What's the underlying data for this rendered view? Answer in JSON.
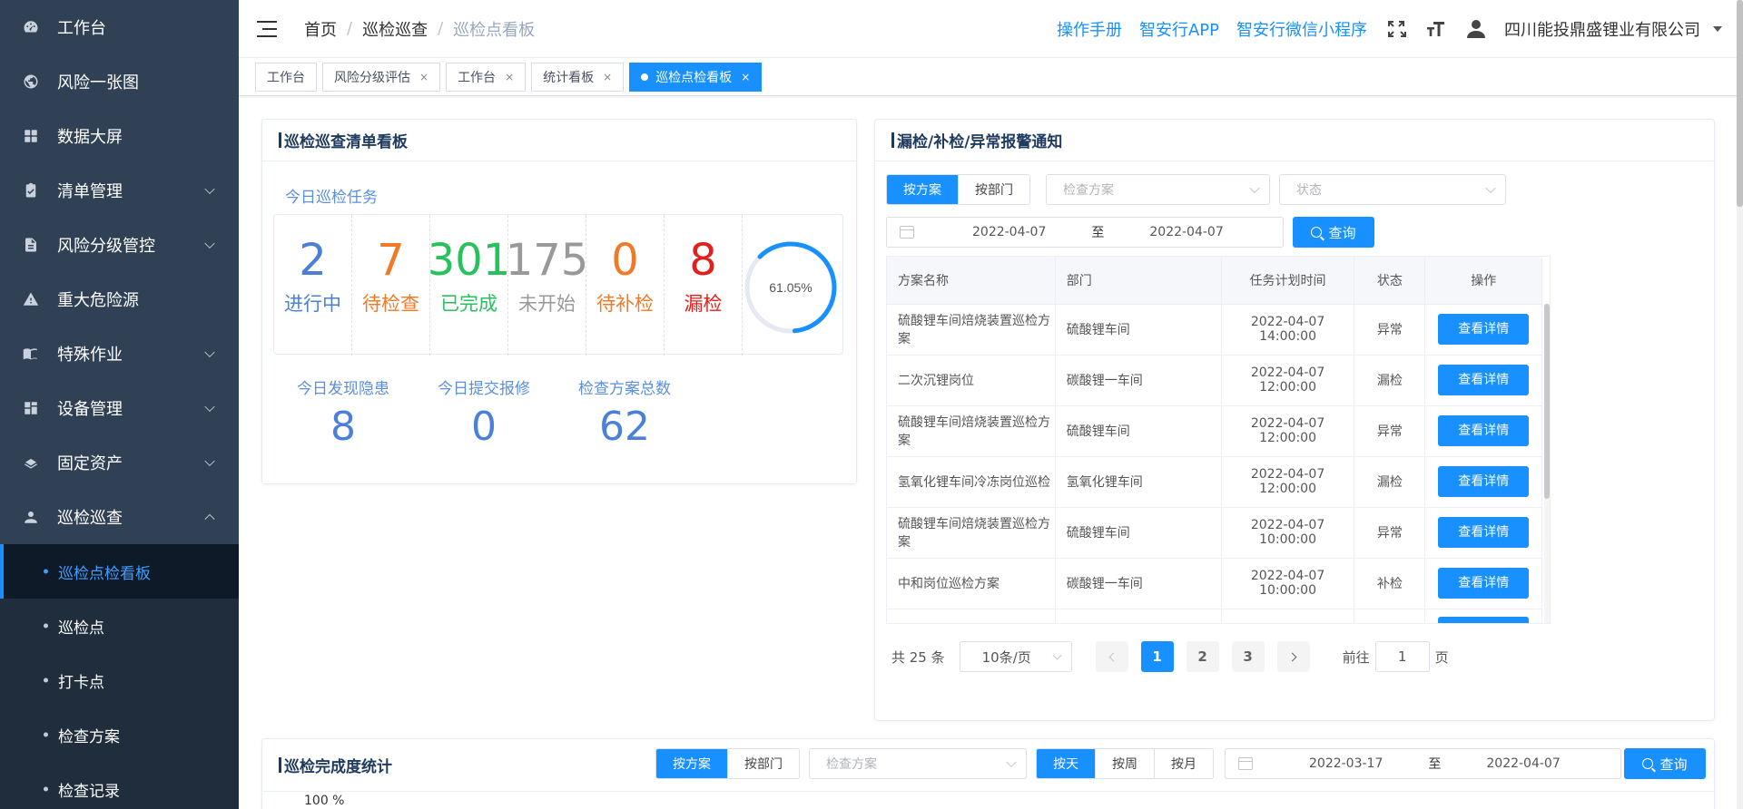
{
  "sidebar": {
    "items": [
      {
        "label": "工作台",
        "icon": "dashboard-icon"
      },
      {
        "label": "风险一张图",
        "icon": "globe-icon"
      },
      {
        "label": "数据大屏",
        "icon": "grid-icon"
      },
      {
        "label": "清单管理",
        "icon": "checklist-icon"
      },
      {
        "label": "风险分级管控",
        "icon": "document-icon"
      },
      {
        "label": "重大危险源",
        "icon": "warning-icon"
      },
      {
        "label": "特殊作业",
        "icon": "book-icon"
      },
      {
        "label": "设备管理",
        "icon": "apps-icon"
      },
      {
        "label": "固定资产",
        "icon": "layers-icon"
      },
      {
        "label": "巡检巡查",
        "icon": "inspector-icon"
      }
    ],
    "submenu": [
      "巡检点检看板",
      "巡检点",
      "打卡点",
      "检查方案",
      "检查记录"
    ]
  },
  "header": {
    "breadcrumb": [
      "首页",
      "巡检巡查",
      "巡检点看板"
    ],
    "links": [
      "操作手册",
      "智安行APP",
      "智安行微信小程序"
    ],
    "company": "四川能投鼎盛锂业有限公司"
  },
  "tabs": [
    {
      "label": "工作台",
      "closable": false
    },
    {
      "label": "风险分级评估",
      "closable": true
    },
    {
      "label": "工作台",
      "closable": true
    },
    {
      "label": "统计看板",
      "closable": true
    },
    {
      "label": "巡检点检看板",
      "closable": true
    }
  ],
  "left_card": {
    "title": "巡检巡查清单看板",
    "today_task_label": "今日巡检任务",
    "stats": [
      {
        "value": "2",
        "label": "进行中",
        "color": "#4a80d8"
      },
      {
        "value": "7",
        "label": "待检查",
        "color": "#f07a28"
      },
      {
        "value": "301",
        "label": "已完成",
        "color": "#27c25e"
      },
      {
        "value": "175",
        "label": "未开始",
        "color": "#999999"
      },
      {
        "value": "0",
        "label": "待补检",
        "color": "#f07a28"
      },
      {
        "value": "8",
        "label": "漏检",
        "color": "#e0201c"
      }
    ],
    "gauge": {
      "percent": 61.05,
      "label": "61.05%",
      "color": "#1890ff"
    },
    "sub_stats": [
      {
        "label": "今日发现隐患",
        "value": "8"
      },
      {
        "label": "今日提交报修",
        "value": "0"
      },
      {
        "label": "检查方案总数",
        "value": "62"
      }
    ]
  },
  "right_card": {
    "title": "漏检/补检/异常报警通知",
    "seg": [
      "按方案",
      "按部门"
    ],
    "select_plan_placeholder": "检查方案",
    "select_status_placeholder": "状态",
    "date_from": "2022-04-07",
    "date_to": "2022-04-07",
    "date_sep": "至",
    "query": "查询",
    "columns": [
      "方案名称",
      "部门",
      "任务计划时间",
      "状态",
      "操作"
    ],
    "rows": [
      [
        "硫酸锂车间焙烧装置巡检方案",
        "硫酸锂车间",
        "2022-04-07 14:00:00",
        "异常",
        "查看详情"
      ],
      [
        "二次沉锂岗位",
        "碳酸锂一车间",
        "2022-04-07 12:00:00",
        "漏检",
        "查看详情"
      ],
      [
        "硫酸锂车间焙烧装置巡检方案",
        "硫酸锂车间",
        "2022-04-07 12:00:00",
        "异常",
        "查看详情"
      ],
      [
        "氢氧化锂车间冷冻岗位巡检",
        "氢氧化锂车间",
        "2022-04-07 12:00:00",
        "漏检",
        "查看详情"
      ],
      [
        "硫酸锂车间焙烧装置巡检方案",
        "硫酸锂车间",
        "2022-04-07 10:00:00",
        "异常",
        "查看详情"
      ],
      [
        "中和岗位巡检方案",
        "碳酸锂一车间",
        "2022-04-07 10:00:00",
        "补检",
        "查看详情"
      ]
    ],
    "pager": {
      "total": "共 25 条",
      "size": "10条/页",
      "pages": [
        "1",
        "2",
        "3"
      ],
      "goto_label": "前往",
      "goto_value": "1",
      "goto_suffix": "页"
    }
  },
  "bottom_card": {
    "title": "巡检完成度统计",
    "seg1": [
      "按方案",
      "按部门"
    ],
    "select_plan_placeholder": "检查方案",
    "seg2": [
      "按天",
      "按周",
      "按月"
    ],
    "date_from": "2022-03-17",
    "date_to": "2022-04-07",
    "date_sep": "至",
    "query": "查询",
    "axis_top": "100 %"
  }
}
